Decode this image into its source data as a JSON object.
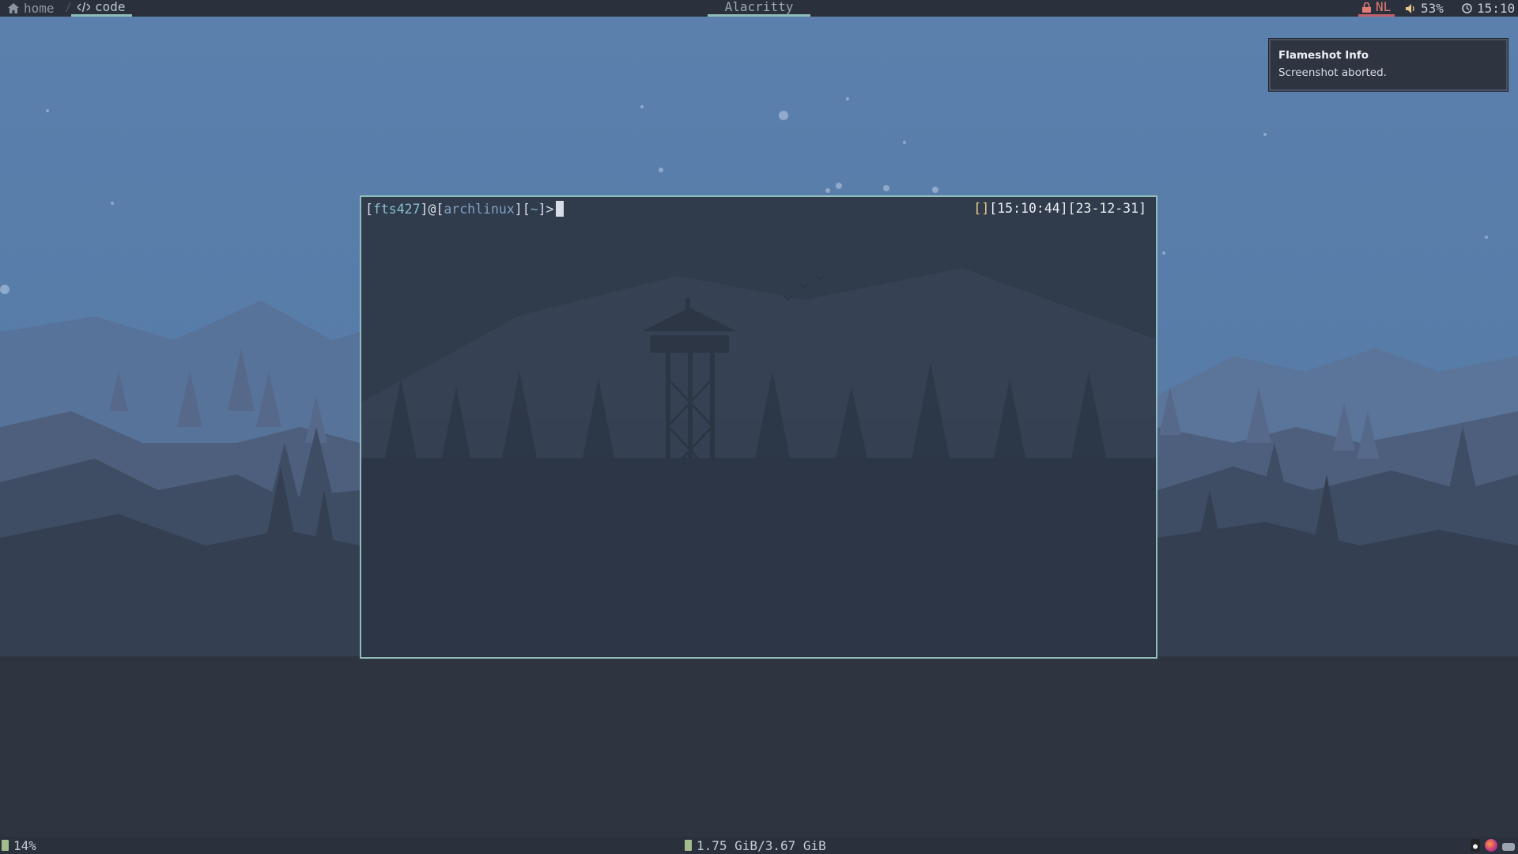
{
  "topbar": {
    "workspaces": [
      {
        "icon": "home-icon",
        "label": "home",
        "active": false
      },
      {
        "icon": "code-icon",
        "label": "code",
        "active": true
      }
    ],
    "separator": "/",
    "window_title": "Alacritty",
    "keyboard_layout": "NL",
    "volume": "53%",
    "clock": "15:10"
  },
  "notification": {
    "title": "Flameshot Info",
    "body": "Screenshot aborted."
  },
  "terminal": {
    "user": "fts427",
    "host": "archlinux",
    "cwd": "~",
    "prompt_symbol": ">",
    "git_status": "",
    "time": "15:10:44",
    "date": "23-12-31"
  },
  "bottombar": {
    "cpu": "14%",
    "memory": "1.75 GiB/3.67 GiB",
    "tray_icons": [
      "tux-icon",
      "firefox-icon",
      "network-icon"
    ]
  },
  "colors": {
    "accent": "#8fbcbb",
    "sky": "#5b80ab",
    "alert": "#bf616a",
    "prompt_bracket": "#ebcb8b"
  }
}
